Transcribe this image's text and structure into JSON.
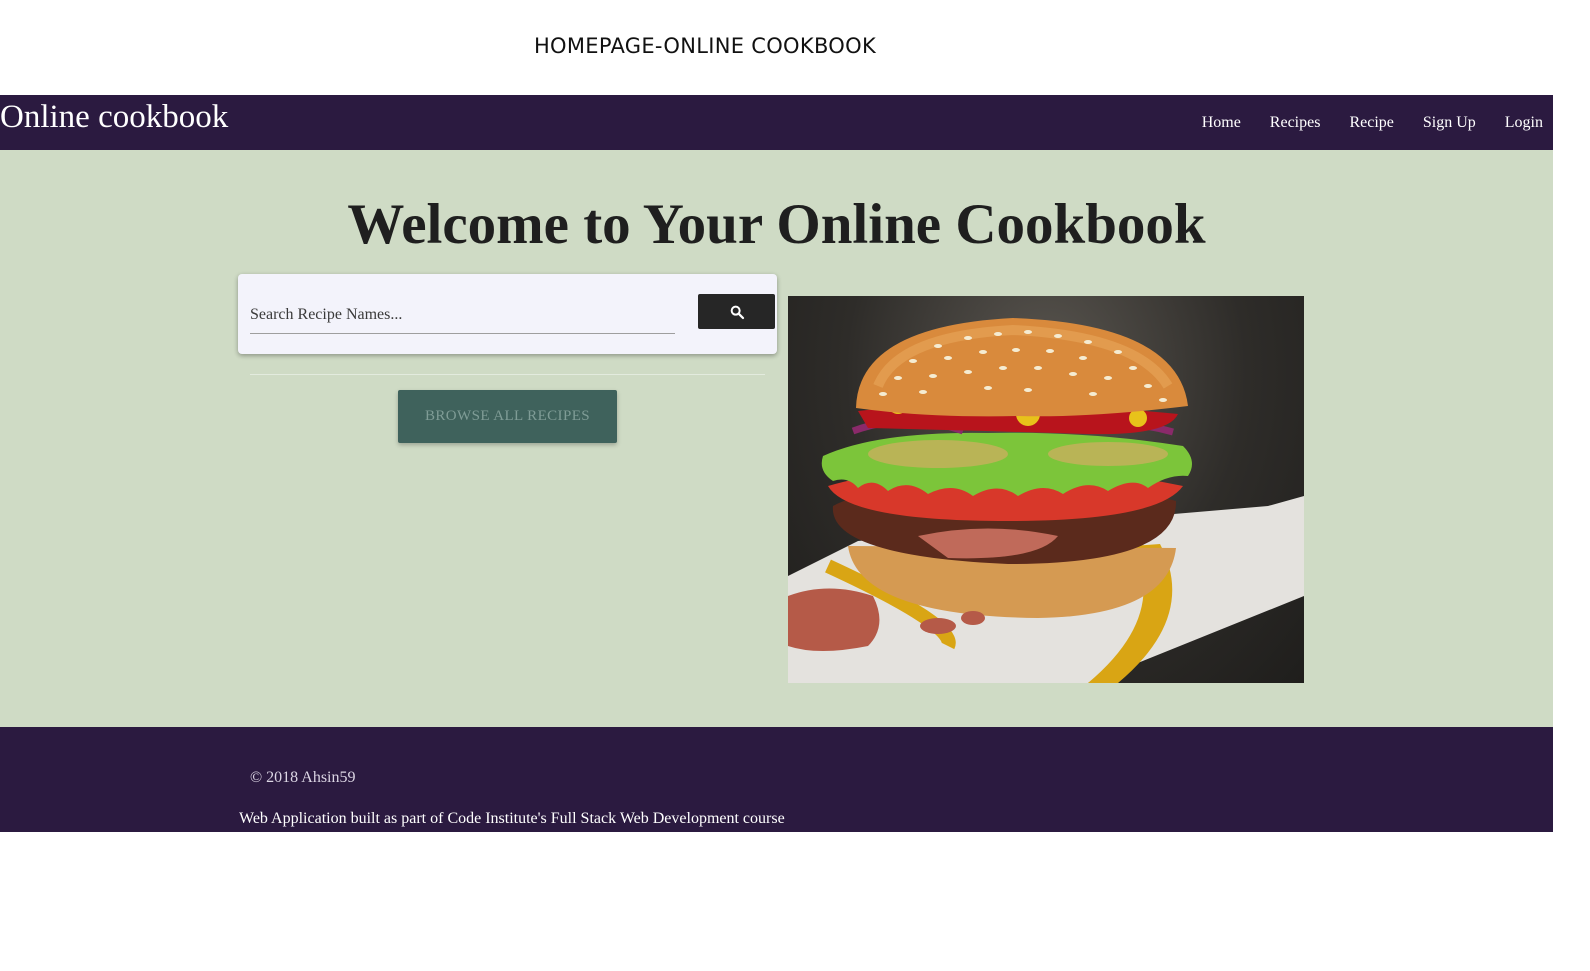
{
  "caption": "HOMEPAGE-ONLINE COOKBOOK",
  "navbar": {
    "brand": "Online cookbook",
    "links": [
      {
        "label": "Home"
      },
      {
        "label": "Recipes"
      },
      {
        "label": "Recipe"
      },
      {
        "label": "Sign Up"
      },
      {
        "label": "Login"
      }
    ]
  },
  "main": {
    "headline": "Welcome to Your Online Cookbook",
    "search": {
      "placeholder": "Search Recipe Names...",
      "value": "",
      "button_icon": "search-icon"
    },
    "browse_button": "BROWSE ALL RECIPES",
    "hero_image": "burger-image"
  },
  "footer": {
    "copyright": "© 2018 Ahsin59",
    "note": "Web Application built as part of Code Institute's Full Stack Web Development course"
  },
  "colors": {
    "navbar": "#2b1a40",
    "main_background": "#cfdbc5",
    "browse_button": "#3f625c",
    "search_button": "#262626"
  }
}
